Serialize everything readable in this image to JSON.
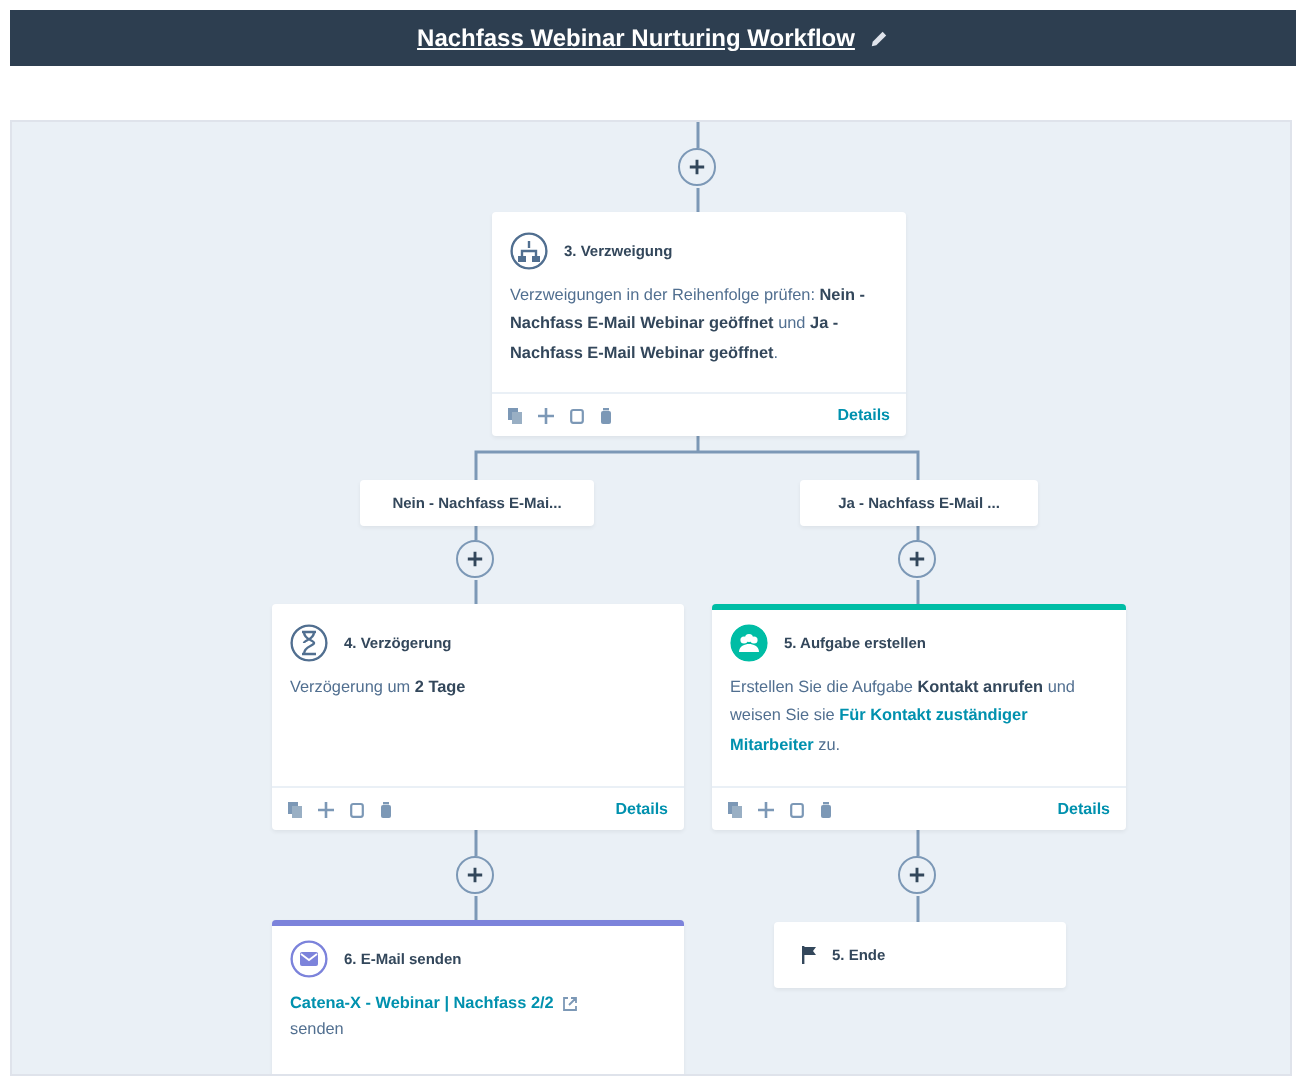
{
  "header": {
    "title": "Nachfass Webinar Nurturing Workflow"
  },
  "actions": [
    {
      "kind": "card",
      "title": "3. Verzweigung",
      "segments": [
        {
          "kind": "plain",
          "text": "Verzweigungen in der Reihenfolge prüfen: "
        },
        {
          "kind": "bold",
          "text": "Nein - Nachfass E-Mail Webinar geöffnet"
        },
        {
          "kind": "plain",
          "text": " und "
        },
        {
          "kind": "bold",
          "text": "Ja - Nachfass E-Mail Webinar geöffnet"
        },
        {
          "kind": "plain",
          "text": "."
        }
      ],
      "details": "Details"
    },
    {
      "kind": "branch",
      "label": "Nein - Nachfass E-Mai..."
    },
    {
      "kind": "branch",
      "label": "Ja - Nachfass E-Mail ..."
    },
    {
      "kind": "card",
      "title": "4. Verzögerung",
      "segments": [
        {
          "kind": "plain",
          "text": "Verzögerung um "
        },
        {
          "kind": "bold",
          "text": "2 Tage"
        }
      ],
      "details": "Details"
    },
    {
      "kind": "card",
      "title": "5. Aufgabe erstellen",
      "segments": [
        {
          "kind": "plain",
          "text": "Erstellen Sie die Aufgabe "
        },
        {
          "kind": "bold",
          "text": "Kontakt anrufen"
        },
        {
          "kind": "plain",
          "text": " und weisen Sie sie "
        },
        {
          "kind": "token",
          "text": "Für Kontakt zuständiger Mitarbeiter"
        },
        {
          "kind": "plain",
          "text": " zu."
        }
      ],
      "details": "Details"
    },
    {
      "kind": "email",
      "title": "6. E-Mail senden",
      "link": "Catena-X - Webinar | Nachfass 2/2",
      "note": "senden"
    },
    {
      "kind": "end",
      "title": "5. Ende"
    }
  ]
}
